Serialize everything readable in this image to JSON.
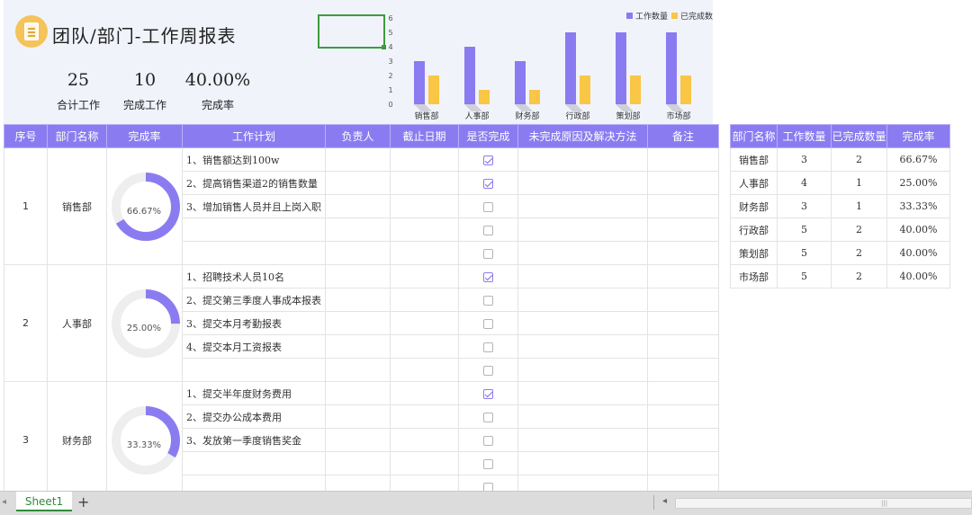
{
  "header": {
    "title": "团队/部门-工作周报表",
    "stats": [
      {
        "value": "25",
        "label": "合计工作"
      },
      {
        "value": "10",
        "label": "完成工作"
      },
      {
        "value": "40.00%",
        "label": "完成率"
      }
    ]
  },
  "chart_data": {
    "type": "bar",
    "categories": [
      "销售部",
      "人事部",
      "财务部",
      "行政部",
      "策划部",
      "市场部"
    ],
    "series": [
      {
        "name": "工作数量",
        "values": [
          3,
          4,
          3,
          5,
          5,
          5
        ],
        "color": "#8a7cf0"
      },
      {
        "name": "已完成数",
        "values": [
          2,
          1,
          1,
          2,
          2,
          2
        ],
        "color": "#f9c646"
      }
    ],
    "ylim": [
      0,
      6
    ],
    "yticks": [
      "0",
      "1",
      "2",
      "3",
      "4",
      "5",
      "6"
    ],
    "legend": "top-right",
    "grid": false
  },
  "table": {
    "headers": [
      "序号",
      "部门名称",
      "完成率",
      "工作计划",
      "负责人",
      "截止日期",
      "是否完成",
      "未完成原因及解决方法",
      "备注"
    ],
    "groups": [
      {
        "index": "1",
        "dept": "销售部",
        "rate": 0.6667,
        "rate_label": "66.67%",
        "rows": [
          {
            "plan": "1、销售额达到100w",
            "done": true
          },
          {
            "plan": "2、提高销售渠道2的销售数量",
            "done": true
          },
          {
            "plan": "3、增加销售人员并且上岗入职",
            "done": false
          },
          {
            "plan": "",
            "done": false
          },
          {
            "plan": "",
            "done": false
          }
        ]
      },
      {
        "index": "2",
        "dept": "人事部",
        "rate": 0.25,
        "rate_label": "25.00%",
        "rows": [
          {
            "plan": "1、招聘技术人员10名",
            "done": true
          },
          {
            "plan": "2、提交第三季度人事成本报表",
            "done": false
          },
          {
            "plan": "3、提交本月考勤报表",
            "done": false
          },
          {
            "plan": "4、提交本月工资报表",
            "done": false
          },
          {
            "plan": "",
            "done": false
          }
        ]
      },
      {
        "index": "3",
        "dept": "财务部",
        "rate": 0.3333,
        "rate_label": "33.33%",
        "rows": [
          {
            "plan": "1、提交半年度财务费用",
            "done": true
          },
          {
            "plan": "2、提交办公成本费用",
            "done": false
          },
          {
            "plan": "3、发放第一季度销售奖金",
            "done": false
          },
          {
            "plan": "",
            "done": false
          },
          {
            "plan": "",
            "done": false
          }
        ]
      }
    ]
  },
  "summary": {
    "headers": [
      "部门名称",
      "工作数量",
      "已完成数量",
      "完成率"
    ],
    "rows": [
      [
        "销售部",
        "3",
        "2",
        "66.67%"
      ],
      [
        "人事部",
        "4",
        "1",
        "25.00%"
      ],
      [
        "财务部",
        "3",
        "1",
        "33.33%"
      ],
      [
        "行政部",
        "5",
        "2",
        "40.00%"
      ],
      [
        "策划部",
        "5",
        "2",
        "40.00%"
      ],
      [
        "市场部",
        "5",
        "2",
        "40.00%"
      ]
    ]
  },
  "tabs": {
    "sheet_name": "Sheet1",
    "add_label": "+"
  },
  "colors": {
    "accent": "#8a7cf0",
    "secondary": "#f9c646",
    "sheet_tab": "#2e8b3a"
  }
}
